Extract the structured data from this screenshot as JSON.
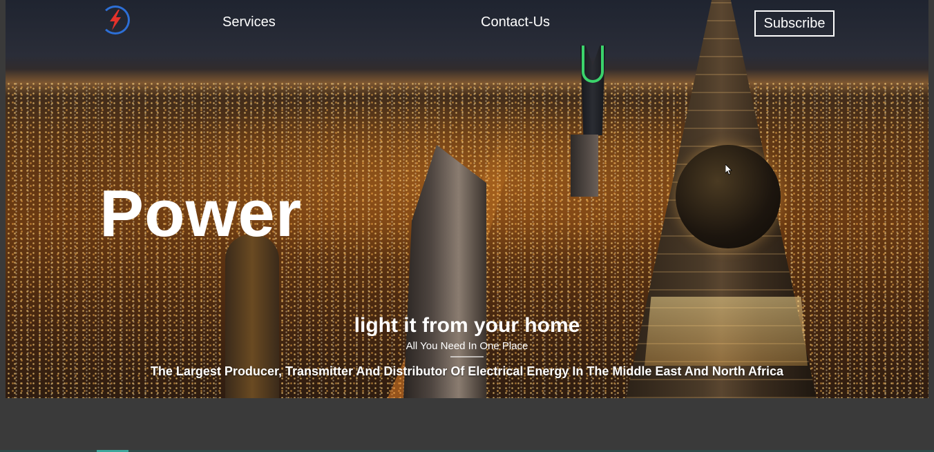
{
  "nav": {
    "logo_icon": "lightning-bolt-logo-icon",
    "services_label": "Services",
    "contact_label": "Contact-Us",
    "subscribe_label": "Subscribe"
  },
  "hero": {
    "title": "Power",
    "tagline": "light it from your home",
    "subtagline": "All You Need In One Place",
    "description": "The Largest Producer, Transmitter And Distributor Of Electrical Energy In The Middle East And North Africa",
    "background_image": "riyadh-night-skyline"
  },
  "colors": {
    "page_background": "#3a3a3a",
    "logo_ring": "#2d6fd6",
    "logo_bolt": "#e5322b",
    "text": "#ffffff",
    "kingdom_tower_light": "#3bd36b"
  }
}
